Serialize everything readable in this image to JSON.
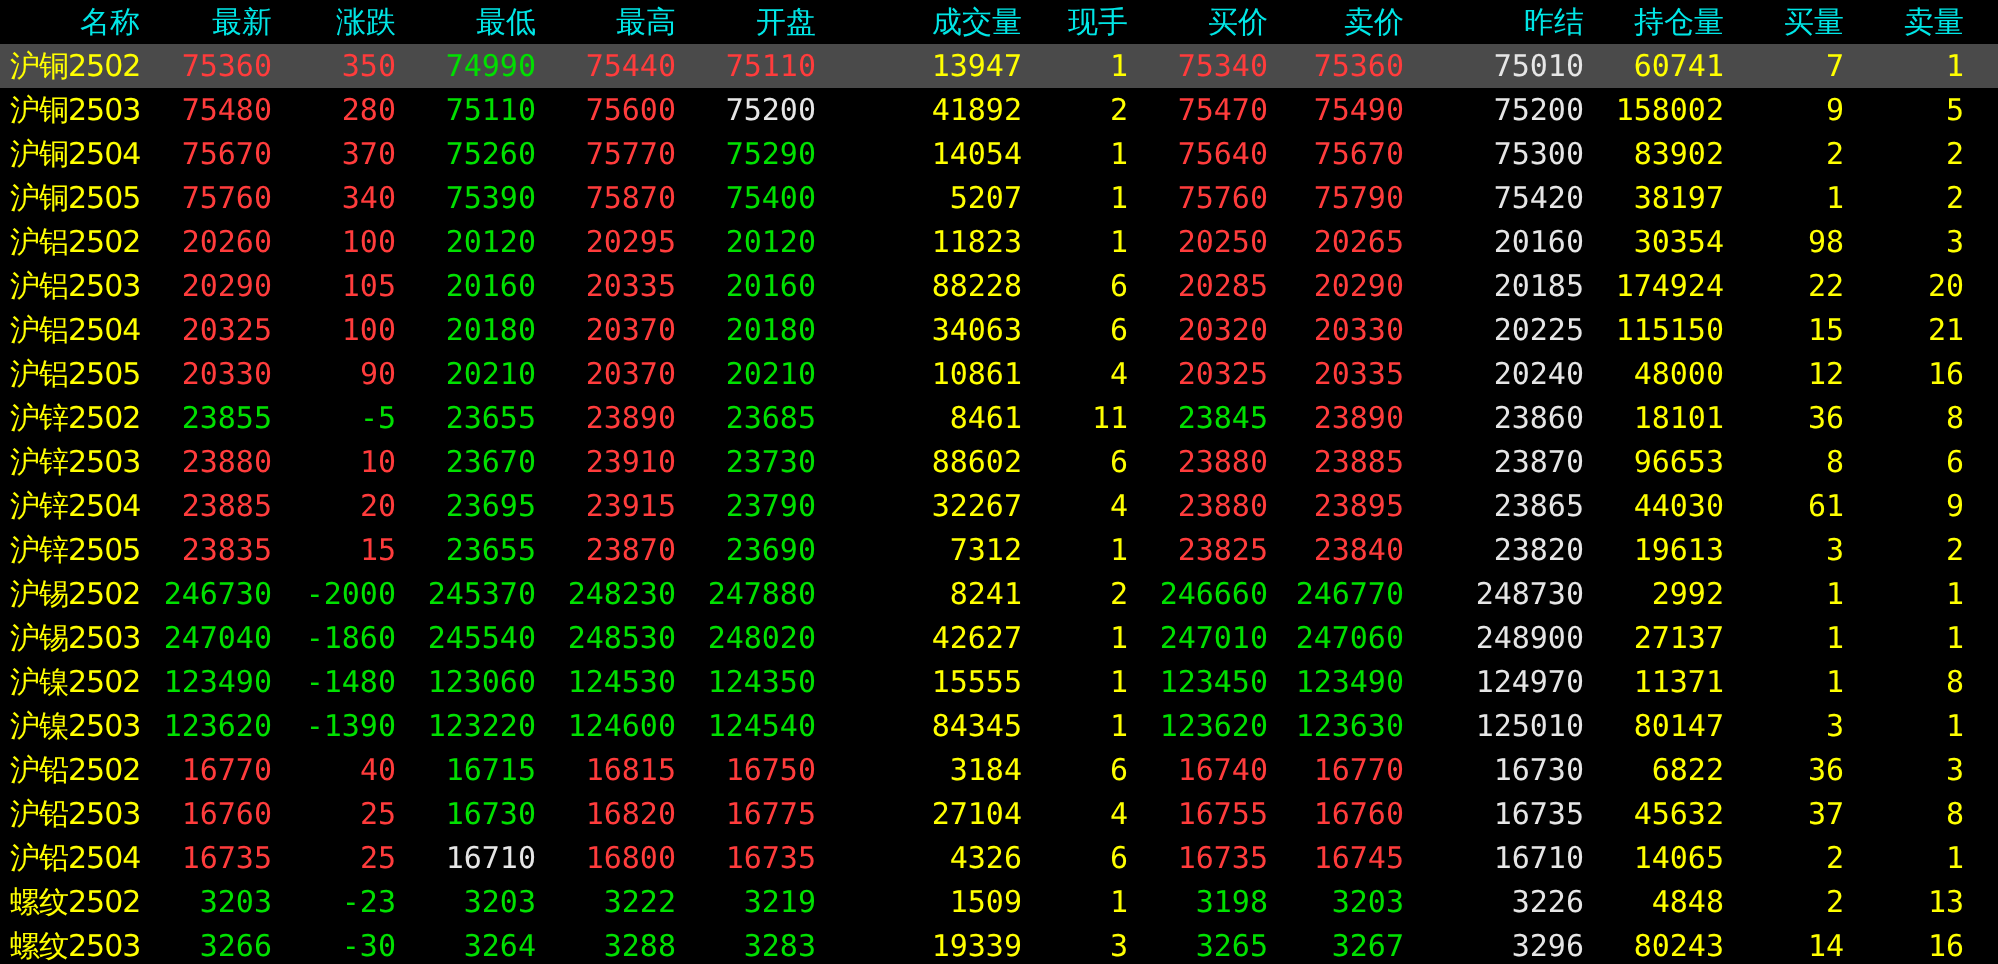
{
  "columns": [
    {
      "label": "名称",
      "kind": "name"
    },
    {
      "label": "最新",
      "kind": "price"
    },
    {
      "label": "涨跌",
      "kind": "price"
    },
    {
      "label": "最低",
      "kind": "price"
    },
    {
      "label": "最高",
      "kind": "price"
    },
    {
      "label": "开盘",
      "kind": "price"
    },
    {
      "label": "成交量",
      "kind": "volume"
    },
    {
      "label": "现手",
      "kind": "volume"
    },
    {
      "label": "买价",
      "kind": "price"
    },
    {
      "label": "卖价",
      "kind": "price"
    },
    {
      "label": "昨结",
      "kind": "ref"
    },
    {
      "label": "持仓量",
      "kind": "volume"
    },
    {
      "label": "买量",
      "kind": "volume"
    },
    {
      "label": "卖量",
      "kind": "volume"
    }
  ],
  "rows": [
    {
      "selected": true,
      "cells": [
        "沪铜2502",
        {
          "text": "75360",
          "color": "#ff3c3c"
        },
        {
          "text": "350",
          "color": "#ff3c3c"
        },
        {
          "text": "74990",
          "color": "#00e000"
        },
        {
          "text": "75440",
          "color": "#ff3c3c"
        },
        {
          "text": "75110",
          "color": "#ff3c3c"
        },
        "13947",
        "1",
        {
          "text": "75340",
          "color": "#ff3c3c"
        },
        {
          "text": "75360",
          "color": "#ff3c3c"
        },
        "75010",
        "60741",
        "7",
        "1"
      ]
    },
    {
      "selected": false,
      "cells": [
        "沪铜2503",
        {
          "text": "75480",
          "color": "#ff3c3c"
        },
        {
          "text": "280",
          "color": "#ff3c3c"
        },
        {
          "text": "75110",
          "color": "#00e000"
        },
        {
          "text": "75600",
          "color": "#ff3c3c"
        },
        {
          "text": "75200",
          "color": "#e6e6e6"
        },
        "41892",
        "2",
        {
          "text": "75470",
          "color": "#ff3c3c"
        },
        {
          "text": "75490",
          "color": "#ff3c3c"
        },
        "75200",
        "158002",
        "9",
        "5"
      ]
    },
    {
      "selected": false,
      "cells": [
        "沪铜2504",
        {
          "text": "75670",
          "color": "#ff3c3c"
        },
        {
          "text": "370",
          "color": "#ff3c3c"
        },
        {
          "text": "75260",
          "color": "#00e000"
        },
        {
          "text": "75770",
          "color": "#ff3c3c"
        },
        {
          "text": "75290",
          "color": "#00e000"
        },
        "14054",
        "1",
        {
          "text": "75640",
          "color": "#ff3c3c"
        },
        {
          "text": "75670",
          "color": "#ff3c3c"
        },
        "75300",
        "83902",
        "2",
        "2"
      ]
    },
    {
      "selected": false,
      "cells": [
        "沪铜2505",
        {
          "text": "75760",
          "color": "#ff3c3c"
        },
        {
          "text": "340",
          "color": "#ff3c3c"
        },
        {
          "text": "75390",
          "color": "#00e000"
        },
        {
          "text": "75870",
          "color": "#ff3c3c"
        },
        {
          "text": "75400",
          "color": "#00e000"
        },
        "5207",
        "1",
        {
          "text": "75760",
          "color": "#ff3c3c"
        },
        {
          "text": "75790",
          "color": "#ff3c3c"
        },
        "75420",
        "38197",
        "1",
        "2"
      ]
    },
    {
      "selected": false,
      "cells": [
        "沪铝2502",
        {
          "text": "20260",
          "color": "#ff3c3c"
        },
        {
          "text": "100",
          "color": "#ff3c3c"
        },
        {
          "text": "20120",
          "color": "#00e000"
        },
        {
          "text": "20295",
          "color": "#ff3c3c"
        },
        {
          "text": "20120",
          "color": "#00e000"
        },
        "11823",
        "1",
        {
          "text": "20250",
          "color": "#ff3c3c"
        },
        {
          "text": "20265",
          "color": "#ff3c3c"
        },
        "20160",
        "30354",
        "98",
        "3"
      ]
    },
    {
      "selected": false,
      "cells": [
        "沪铝2503",
        {
          "text": "20290",
          "color": "#ff3c3c"
        },
        {
          "text": "105",
          "color": "#ff3c3c"
        },
        {
          "text": "20160",
          "color": "#00e000"
        },
        {
          "text": "20335",
          "color": "#ff3c3c"
        },
        {
          "text": "20160",
          "color": "#00e000"
        },
        "88228",
        "6",
        {
          "text": "20285",
          "color": "#ff3c3c"
        },
        {
          "text": "20290",
          "color": "#ff3c3c"
        },
        "20185",
        "174924",
        "22",
        "20"
      ]
    },
    {
      "selected": false,
      "cells": [
        "沪铝2504",
        {
          "text": "20325",
          "color": "#ff3c3c"
        },
        {
          "text": "100",
          "color": "#ff3c3c"
        },
        {
          "text": "20180",
          "color": "#00e000"
        },
        {
          "text": "20370",
          "color": "#ff3c3c"
        },
        {
          "text": "20180",
          "color": "#00e000"
        },
        "34063",
        "6",
        {
          "text": "20320",
          "color": "#ff3c3c"
        },
        {
          "text": "20330",
          "color": "#ff3c3c"
        },
        "20225",
        "115150",
        "15",
        "21"
      ]
    },
    {
      "selected": false,
      "cells": [
        "沪铝2505",
        {
          "text": "20330",
          "color": "#ff3c3c"
        },
        {
          "text": "90",
          "color": "#ff3c3c"
        },
        {
          "text": "20210",
          "color": "#00e000"
        },
        {
          "text": "20370",
          "color": "#ff3c3c"
        },
        {
          "text": "20210",
          "color": "#00e000"
        },
        "10861",
        "4",
        {
          "text": "20325",
          "color": "#ff3c3c"
        },
        {
          "text": "20335",
          "color": "#ff3c3c"
        },
        "20240",
        "48000",
        "12",
        "16"
      ]
    },
    {
      "selected": false,
      "cells": [
        "沪锌2502",
        {
          "text": "23855",
          "color": "#00e000"
        },
        {
          "text": "-5",
          "color": "#00e000"
        },
        {
          "text": "23655",
          "color": "#00e000"
        },
        {
          "text": "23890",
          "color": "#ff3c3c"
        },
        {
          "text": "23685",
          "color": "#00e000"
        },
        "8461",
        "11",
        {
          "text": "23845",
          "color": "#00e000"
        },
        {
          "text": "23890",
          "color": "#ff3c3c"
        },
        "23860",
        "18101",
        "36",
        "8"
      ]
    },
    {
      "selected": false,
      "cells": [
        "沪锌2503",
        {
          "text": "23880",
          "color": "#ff3c3c"
        },
        {
          "text": "10",
          "color": "#ff3c3c"
        },
        {
          "text": "23670",
          "color": "#00e000"
        },
        {
          "text": "23910",
          "color": "#ff3c3c"
        },
        {
          "text": "23730",
          "color": "#00e000"
        },
        "88602",
        "6",
        {
          "text": "23880",
          "color": "#ff3c3c"
        },
        {
          "text": "23885",
          "color": "#ff3c3c"
        },
        "23870",
        "96653",
        "8",
        "6"
      ]
    },
    {
      "selected": false,
      "cells": [
        "沪锌2504",
        {
          "text": "23885",
          "color": "#ff3c3c"
        },
        {
          "text": "20",
          "color": "#ff3c3c"
        },
        {
          "text": "23695",
          "color": "#00e000"
        },
        {
          "text": "23915",
          "color": "#ff3c3c"
        },
        {
          "text": "23790",
          "color": "#00e000"
        },
        "32267",
        "4",
        {
          "text": "23880",
          "color": "#ff3c3c"
        },
        {
          "text": "23895",
          "color": "#ff3c3c"
        },
        "23865",
        "44030",
        "61",
        "9"
      ]
    },
    {
      "selected": false,
      "cells": [
        "沪锌2505",
        {
          "text": "23835",
          "color": "#ff3c3c"
        },
        {
          "text": "15",
          "color": "#ff3c3c"
        },
        {
          "text": "23655",
          "color": "#00e000"
        },
        {
          "text": "23870",
          "color": "#ff3c3c"
        },
        {
          "text": "23690",
          "color": "#00e000"
        },
        "7312",
        "1",
        {
          "text": "23825",
          "color": "#ff3c3c"
        },
        {
          "text": "23840",
          "color": "#ff3c3c"
        },
        "23820",
        "19613",
        "3",
        "2"
      ]
    },
    {
      "selected": false,
      "cells": [
        "沪锡2502",
        {
          "text": "246730",
          "color": "#00e000"
        },
        {
          "text": "-2000",
          "color": "#00e000"
        },
        {
          "text": "245370",
          "color": "#00e000"
        },
        {
          "text": "248230",
          "color": "#00e000"
        },
        {
          "text": "247880",
          "color": "#00e000"
        },
        "8241",
        "2",
        {
          "text": "246660",
          "color": "#00e000"
        },
        {
          "text": "246770",
          "color": "#00e000"
        },
        "248730",
        "2992",
        "1",
        "1"
      ]
    },
    {
      "selected": false,
      "cells": [
        "沪锡2503",
        {
          "text": "247040",
          "color": "#00e000"
        },
        {
          "text": "-1860",
          "color": "#00e000"
        },
        {
          "text": "245540",
          "color": "#00e000"
        },
        {
          "text": "248530",
          "color": "#00e000"
        },
        {
          "text": "248020",
          "color": "#00e000"
        },
        "42627",
        "1",
        {
          "text": "247010",
          "color": "#00e000"
        },
        {
          "text": "247060",
          "color": "#00e000"
        },
        "248900",
        "27137",
        "1",
        "1"
      ]
    },
    {
      "selected": false,
      "cells": [
        "沪镍2502",
        {
          "text": "123490",
          "color": "#00e000"
        },
        {
          "text": "-1480",
          "color": "#00e000"
        },
        {
          "text": "123060",
          "color": "#00e000"
        },
        {
          "text": "124530",
          "color": "#00e000"
        },
        {
          "text": "124350",
          "color": "#00e000"
        },
        "15555",
        "1",
        {
          "text": "123450",
          "color": "#00e000"
        },
        {
          "text": "123490",
          "color": "#00e000"
        },
        "124970",
        "11371",
        "1",
        "8"
      ]
    },
    {
      "selected": false,
      "cells": [
        "沪镍2503",
        {
          "text": "123620",
          "color": "#00e000"
        },
        {
          "text": "-1390",
          "color": "#00e000"
        },
        {
          "text": "123220",
          "color": "#00e000"
        },
        {
          "text": "124600",
          "color": "#00e000"
        },
        {
          "text": "124540",
          "color": "#00e000"
        },
        "84345",
        "1",
        {
          "text": "123620",
          "color": "#00e000"
        },
        {
          "text": "123630",
          "color": "#00e000"
        },
        "125010",
        "80147",
        "3",
        "1"
      ]
    },
    {
      "selected": false,
      "cells": [
        "沪铅2502",
        {
          "text": "16770",
          "color": "#ff3c3c"
        },
        {
          "text": "40",
          "color": "#ff3c3c"
        },
        {
          "text": "16715",
          "color": "#00e000"
        },
        {
          "text": "16815",
          "color": "#ff3c3c"
        },
        {
          "text": "16750",
          "color": "#ff3c3c"
        },
        "3184",
        "6",
        {
          "text": "16740",
          "color": "#ff3c3c"
        },
        {
          "text": "16770",
          "color": "#ff3c3c"
        },
        "16730",
        "6822",
        "36",
        "3"
      ]
    },
    {
      "selected": false,
      "cells": [
        "沪铅2503",
        {
          "text": "16760",
          "color": "#ff3c3c"
        },
        {
          "text": "25",
          "color": "#ff3c3c"
        },
        {
          "text": "16730",
          "color": "#00e000"
        },
        {
          "text": "16820",
          "color": "#ff3c3c"
        },
        {
          "text": "16775",
          "color": "#ff3c3c"
        },
        "27104",
        "4",
        {
          "text": "16755",
          "color": "#ff3c3c"
        },
        {
          "text": "16760",
          "color": "#ff3c3c"
        },
        "16735",
        "45632",
        "37",
        "8"
      ]
    },
    {
      "selected": false,
      "cells": [
        "沪铅2504",
        {
          "text": "16735",
          "color": "#ff3c3c"
        },
        {
          "text": "25",
          "color": "#ff3c3c"
        },
        {
          "text": "16710",
          "color": "#e6e6e6"
        },
        {
          "text": "16800",
          "color": "#ff3c3c"
        },
        {
          "text": "16735",
          "color": "#ff3c3c"
        },
        "4326",
        "6",
        {
          "text": "16735",
          "color": "#ff3c3c"
        },
        {
          "text": "16745",
          "color": "#ff3c3c"
        },
        "16710",
        "14065",
        "2",
        "1"
      ]
    },
    {
      "selected": false,
      "cells": [
        "螺纹2502",
        {
          "text": "3203",
          "color": "#00e000"
        },
        {
          "text": "-23",
          "color": "#00e000"
        },
        {
          "text": "3203",
          "color": "#00e000"
        },
        {
          "text": "3222",
          "color": "#00e000"
        },
        {
          "text": "3219",
          "color": "#00e000"
        },
        "1509",
        "1",
        {
          "text": "3198",
          "color": "#00e000"
        },
        {
          "text": "3203",
          "color": "#00e000"
        },
        "3226",
        "4848",
        "2",
        "13"
      ]
    },
    {
      "selected": false,
      "cells": [
        "螺纹2503",
        {
          "text": "3266",
          "color": "#00e000"
        },
        {
          "text": "-30",
          "color": "#00e000"
        },
        {
          "text": "3264",
          "color": "#00e000"
        },
        {
          "text": "3288",
          "color": "#00e000"
        },
        {
          "text": "3283",
          "color": "#00e000"
        },
        "19339",
        "3",
        {
          "text": "3265",
          "color": "#00e000"
        },
        {
          "text": "3267",
          "color": "#00e000"
        },
        "3296",
        "80243",
        "14",
        "16"
      ]
    }
  ]
}
